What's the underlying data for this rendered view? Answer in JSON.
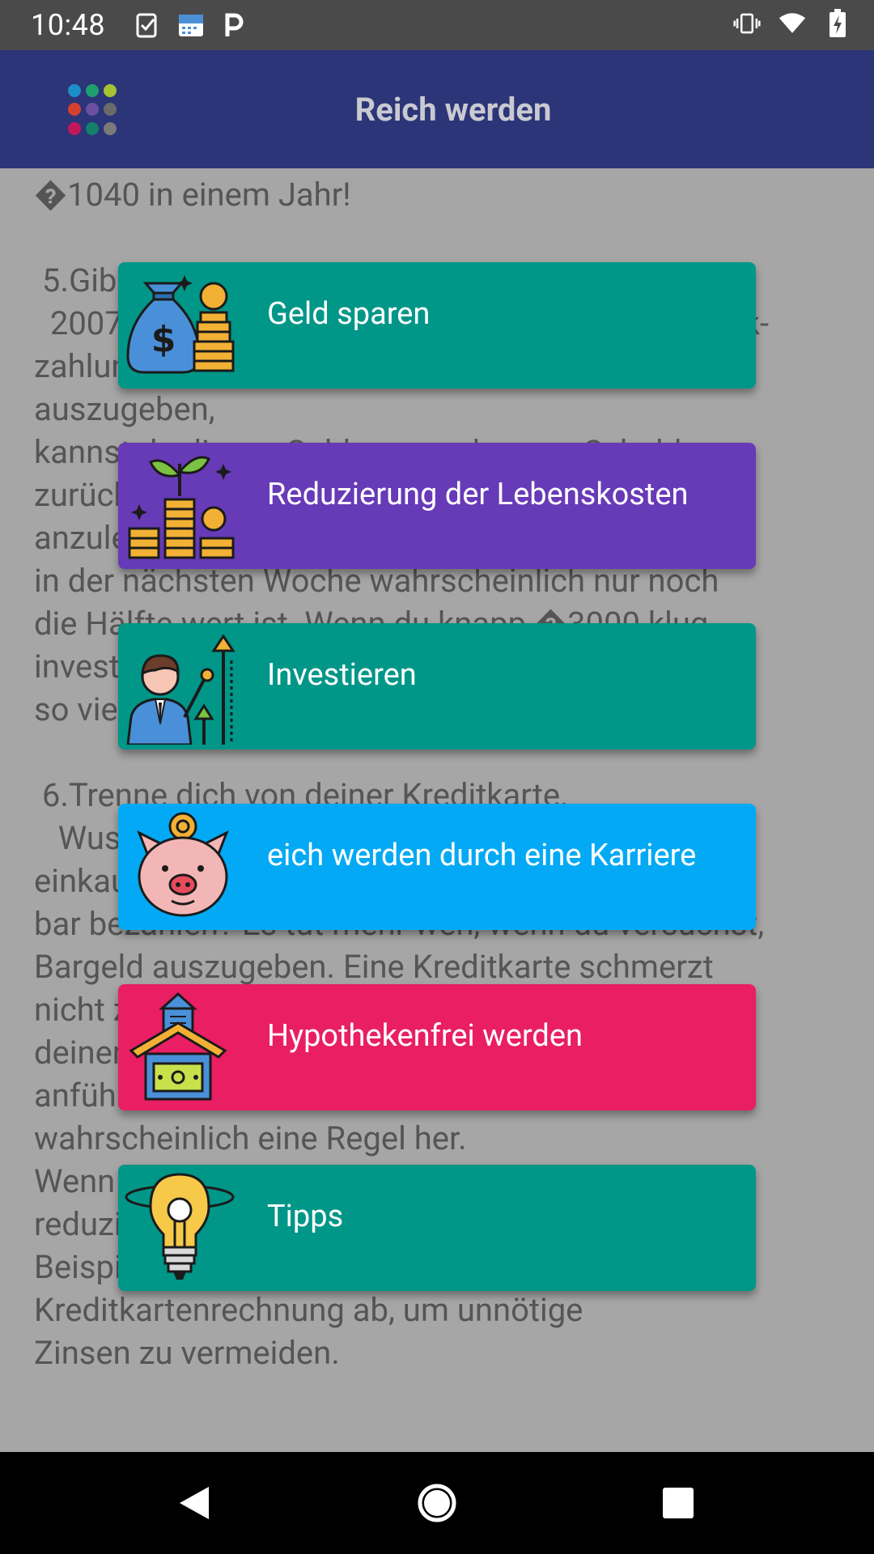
{
  "status_bar": {
    "time": "10:48",
    "left_icons": [
      "checklist-icon",
      "calendar-icon",
      "parking-icon"
    ],
    "right_icons": [
      "vibrate-icon",
      "wifi-icon",
      "battery-charging-icon"
    ]
  },
  "app_bar": {
    "title": "Reich werden",
    "logo_icon": "dots-grid-logo"
  },
  "article": {
    "text": "�1040 in einem Jahr!\n\n 5.Gib deine Steuerrückerstattung nicht aus.\n  2007 haben Menschen im Durchschnitt eine Rück-\nzahlung von mehr als �2000 erhalten. Statt es auszugeben,\nkannst du dieses Geld verwenden, um Schulden\nzurückzuzahlen oder ein Polster für Notfälle\nanzulegen. Wenn du das Geld ausgibst, ist es\nin der nächsten Woche wahrscheinlich nur noch\ndie Hälfte wert ist. Wenn du knapp �3000 klug\ninvestierst, kann es in ein paar Jahren zehn Mal\nso viel wert sein.\n\n 6.Trenne dich von deiner Kreditkarte.\n   Wusstest du, dass Leute, die mit Kreditkarten\neinkaufen, mehr ausgeben als Leute, die\nbar bezahlen? Es tut mehr weh, wenn du versuchst,\nBargeld auszugeben. Eine Kreditkarte schmerzt\nnicht zu sehr. Wenn du kannst, trenne dich von\ndeiner Kreditkarte. Du kannst Notfälle\nanführen, aber wenn du sie hast, dann muss\nwahrscheinlich eine Regel her.\nWenn du eine Kreditkarte weiterhin benutzt,\nreduziere die Anzahl, die du hast. Zum\nBeispiel zahle jeden Monat die gesamte\nKreditkartenrechnung ab, um unnötige\nZinsen zu vermeiden."
  },
  "menu": [
    {
      "label": "Geld sparen",
      "icon": "money-bag-coins-icon",
      "color": "#009688"
    },
    {
      "label": "Reduzierung der Lebenskosten",
      "icon": "plant-coins-icon",
      "color": "#673ab7"
    },
    {
      "label": "Investieren",
      "icon": "businessman-growth-icon",
      "color": "#009688"
    },
    {
      "label": "eich werden durch eine Karriere",
      "icon": "piggy-bank-icon",
      "color": "#03a9f4"
    },
    {
      "label": "Hypothekenfrei werden",
      "icon": "house-money-icon",
      "color": "#e91e63"
    },
    {
      "label": "Tipps",
      "icon": "lightbulb-icon",
      "color": "#009688"
    }
  ],
  "nav_bar": {
    "back": "back-triangle-icon",
    "home": "home-circle-icon",
    "recents": "recents-square-icon"
  }
}
